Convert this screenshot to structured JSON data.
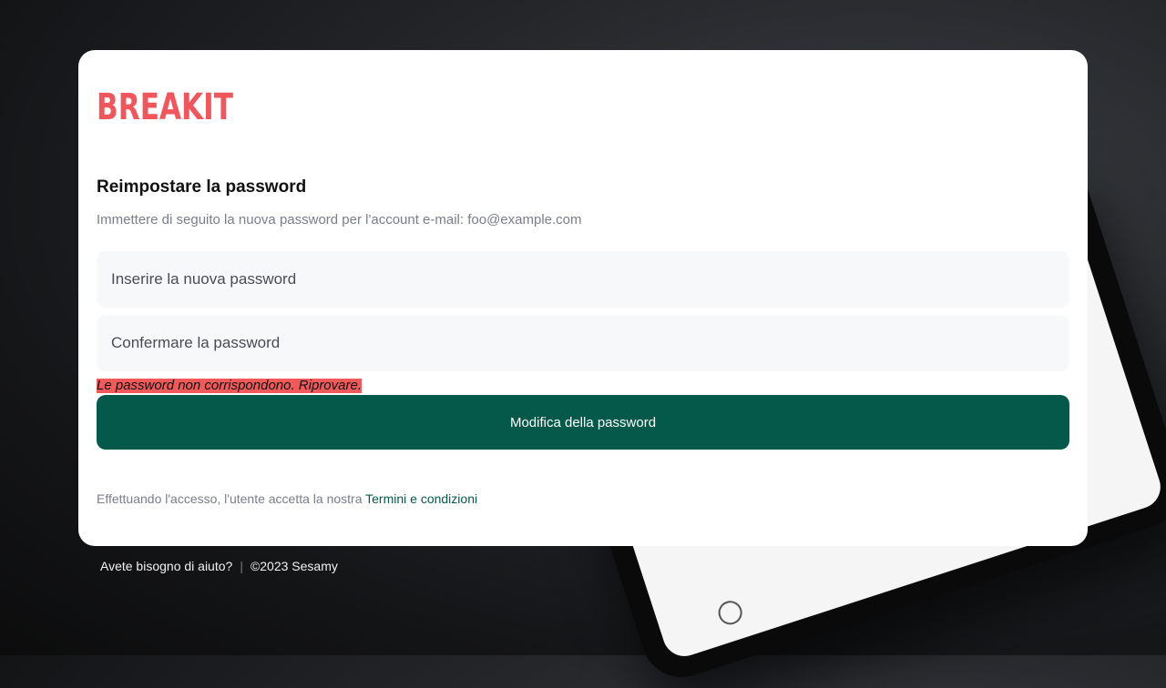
{
  "brand": {
    "logo_text": "BREAKIT",
    "logo_color": "#f2565d"
  },
  "reset": {
    "title": "Reimpostare la password",
    "subtitle": "Immettere di seguito la nuova password per l'account e-mail: foo@example.com",
    "new_password_placeholder": "Inserire la nuova password",
    "confirm_password_placeholder": "Confermare la password",
    "error_message": "Le password non corrispondono. Riprovare.",
    "submit_label": "Modifica della password"
  },
  "terms": {
    "prefix": "Effettuando l'accesso, l'utente accetta la nostra",
    "link_label": "Termini e condizioni"
  },
  "footer": {
    "help_label": "Avete bisogno di aiuto?",
    "separator": "|",
    "copyright": "©2023 Sesamy"
  },
  "colors": {
    "accent": "#04594a",
    "error": "#f05a5a",
    "brand": "#f2565d"
  }
}
